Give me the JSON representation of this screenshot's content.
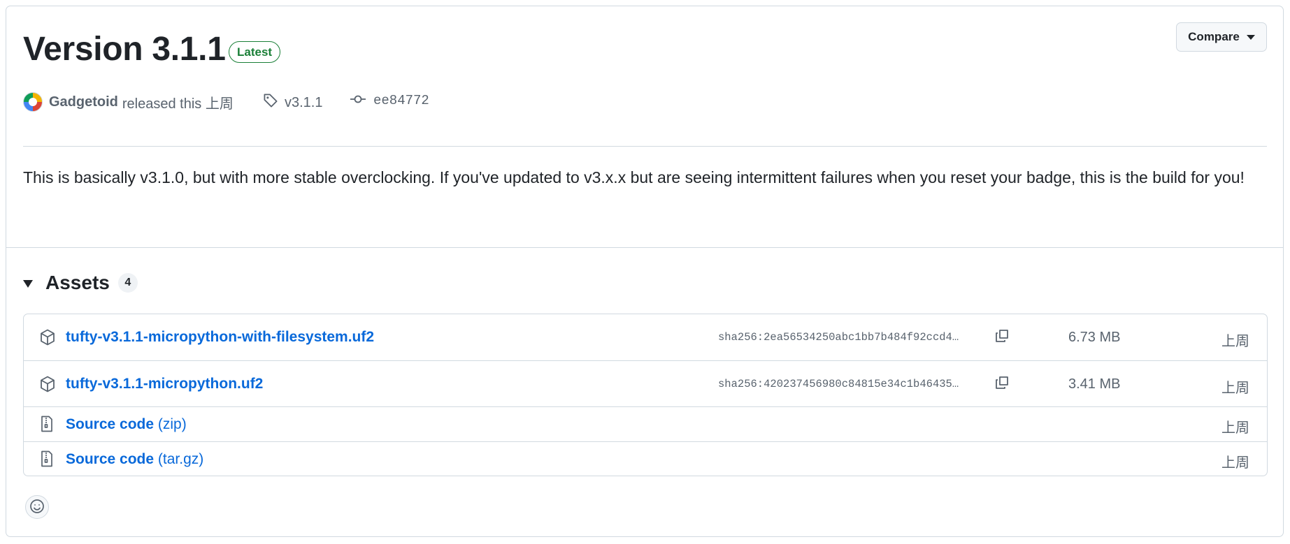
{
  "release": {
    "title": "Version 3.1.1",
    "badge": "Latest",
    "compare_label": "Compare",
    "author": "Gadgetoid",
    "released_text": "released this 上周",
    "tag": "v3.1.1",
    "commit": "ee84772",
    "description": "This is basically v3.1.0, but with more stable overclocking. If you've updated to v3.x.x but are seeing intermittent failures when you reset your badge, this is the build for you!"
  },
  "assets": {
    "title": "Assets",
    "count": "4",
    "items": [
      {
        "name": "tufty-v3.1.1-micropython-with-filesystem.uf2",
        "sha": "sha256:2ea56534250abc1bb7b484f92ccd4…",
        "size": "6.73 MB",
        "date": "上周",
        "icon": "package-icon"
      },
      {
        "name": "tufty-v3.1.1-micropython.uf2",
        "sha": "sha256:420237456980c84815e34c1b46435…",
        "size": "3.41 MB",
        "date": "上周",
        "icon": "package-icon"
      },
      {
        "name": "Source code",
        "ext": "(zip)",
        "date": "上周",
        "icon": "file-zip-icon"
      },
      {
        "name": "Source code",
        "ext": "(tar.gz)",
        "date": "上周",
        "icon": "file-zip-icon"
      }
    ]
  },
  "colors": {
    "accent": "#0969da",
    "latest": "#1a7f37",
    "muted": "#59636e",
    "border": "#d1d9e0"
  }
}
